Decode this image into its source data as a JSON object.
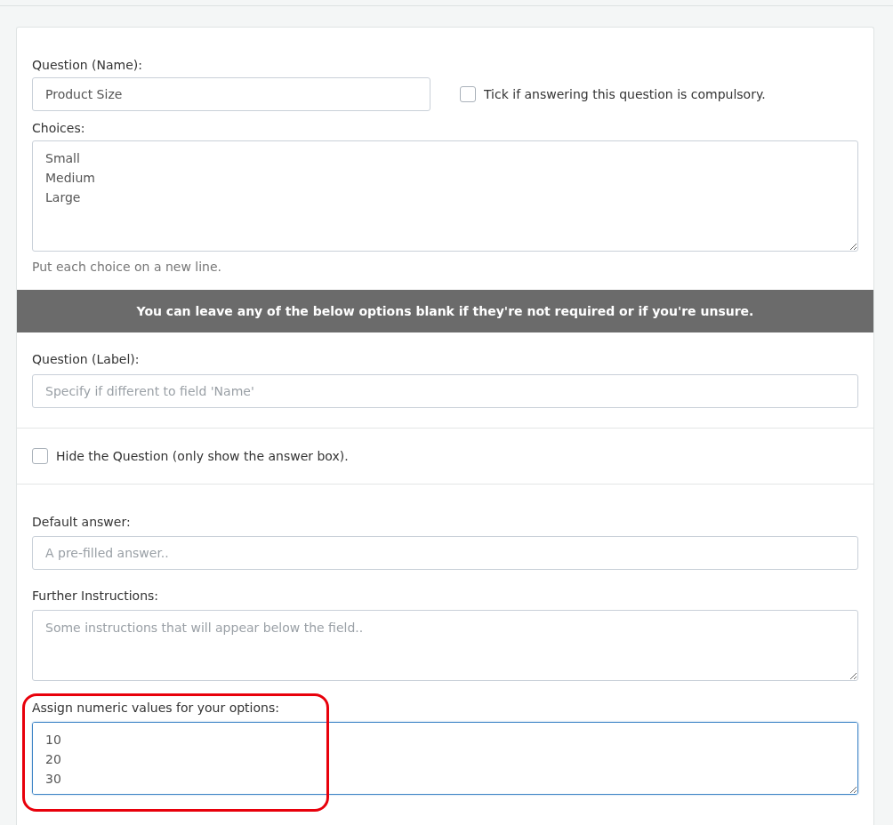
{
  "question_name": {
    "label": "Question (Name):",
    "value": "Product Size"
  },
  "compulsory": {
    "label": "Tick if answering this question is compulsory.",
    "checked": false
  },
  "choices": {
    "label": "Choices:",
    "lines": [
      "Small",
      "Medium",
      "Large"
    ],
    "help": "Put each choice on a new line."
  },
  "banner": "You can leave any of the below options blank if they're not required or if you're unsure.",
  "question_label": {
    "label": "Question (Label):",
    "placeholder": "Specify if different to field 'Name'"
  },
  "hide_question": {
    "label": "Hide the Question (only show the answer box).",
    "checked": false
  },
  "default_answer": {
    "label": "Default answer:",
    "placeholder": "A pre-filled answer.."
  },
  "further_instructions": {
    "label": "Further Instructions:",
    "placeholder": "Some instructions that will appear below the field.."
  },
  "numeric_values": {
    "label": "Assign numeric values for your options:",
    "lines": [
      "10",
      "20",
      "30"
    ],
    "focused": true,
    "highlighted": true
  }
}
